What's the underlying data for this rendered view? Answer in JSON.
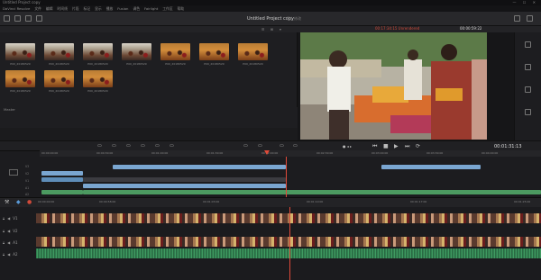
{
  "window": {
    "title": "Untitled Project copy",
    "controls": "— ☐ ✕"
  },
  "menu": [
    "DaVinci Resolve",
    "文件",
    "编辑",
    "时间线",
    "片段",
    "标记",
    "显示",
    "播放",
    "Fusion",
    "调色",
    "Fairlight",
    "工作区",
    "帮助"
  ],
  "toolbar": {
    "project_name": "Untitled Project copy",
    "sub_label": "已上修改"
  },
  "media_pool": {
    "header_items": [
      "☰",
      "⊞",
      "▾"
    ],
    "clips": [
      {
        "name": "P00_20180529",
        "style": "crowd"
      },
      {
        "name": "P00_20180529",
        "style": "crowd"
      },
      {
        "name": "P00_20180529",
        "style": "crowd"
      },
      {
        "name": "P00_20180529",
        "style": "crowd"
      },
      {
        "name": "P00_20180529",
        "style": "orange"
      },
      {
        "name": "P00_20180529",
        "style": "orange"
      },
      {
        "name": "P00_20180529",
        "style": "orange"
      },
      {
        "name": "P00_20180529",
        "style": "orange"
      },
      {
        "name": "P00_20180529",
        "style": "orange"
      },
      {
        "name": "P00_20180529",
        "style": "orange"
      }
    ],
    "bin_label": "Master"
  },
  "viewer": {
    "warning": "00:17:34:15 Unrendered",
    "timecode_top": "00:00:59:22",
    "timecode_main": "00:01:31:13"
  },
  "timeline": {
    "ruler_upper": [
      "00:00:00:00",
      "00:00:30:00",
      "00:01:00:00",
      "00:01:30:00",
      "00:02:00:00",
      "00:02:30:00",
      "00:03:00:00",
      "00:03:30:00",
      "00:04:00:00"
    ],
    "ruler_lower": [
      "00:00:00:00",
      "00:00:58:00",
      "00:01:03:00",
      "00:01:10:00",
      "00:01:17:00",
      "00:01:25:00"
    ],
    "upper_tracks": [
      "V3",
      "V2",
      "V1",
      "A1",
      "A2"
    ],
    "lower_tracks": [
      {
        "id": "V1",
        "type": "video"
      },
      {
        "id": "V2",
        "type": "video"
      },
      {
        "id": "A1",
        "type": "audio"
      },
      {
        "id": "A2",
        "type": "audio"
      }
    ]
  },
  "colors": {
    "accent_red": "#e04b3a",
    "clip_blue": "#7aa6d1",
    "clip_green": "#4c9a60"
  }
}
